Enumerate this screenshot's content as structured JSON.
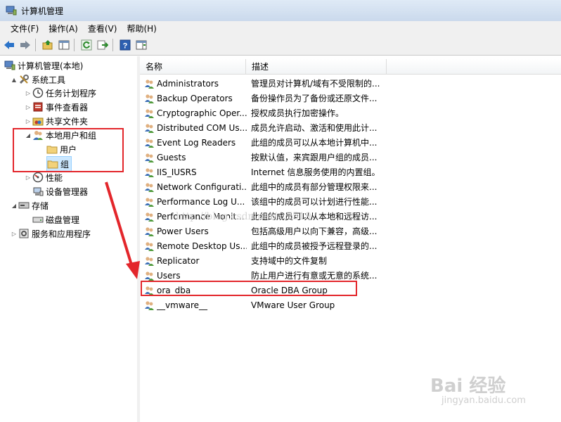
{
  "window": {
    "title": "计算机管理"
  },
  "menu": [
    "文件(F)",
    "操作(A)",
    "查看(V)",
    "帮助(H)"
  ],
  "toolbar_icons": [
    "back-icon",
    "forward-icon",
    "up-folder-icon",
    "show-hide-tree-icon",
    "refresh-icon",
    "export-list-icon",
    "help-icon",
    "action-pane-icon"
  ],
  "tree": [
    {
      "label": "计算机管理(本地)",
      "icon": "computer-management-icon",
      "arrow": ""
    },
    {
      "label": "系统工具",
      "icon": "tools-icon",
      "arrow": "▲"
    },
    {
      "label": "任务计划程序",
      "icon": "clock-icon",
      "arrow": "▷"
    },
    {
      "label": "事件查看器",
      "icon": "event-viewer-icon",
      "arrow": "▷"
    },
    {
      "label": "共享文件夹",
      "icon": "shared-folder-icon",
      "arrow": "▷"
    },
    {
      "label": "本地用户和组",
      "icon": "users-icon",
      "arrow": "◢"
    },
    {
      "label": "用户",
      "icon": "folder-icon",
      "arrow": ""
    },
    {
      "label": "组",
      "icon": "folder-icon",
      "arrow": ""
    },
    {
      "label": "性能",
      "icon": "performance-icon",
      "arrow": "▷"
    },
    {
      "label": "设备管理器",
      "icon": "device-manager-icon",
      "arrow": ""
    },
    {
      "label": "存储",
      "icon": "storage-icon",
      "arrow": "◢"
    },
    {
      "label": "磁盘管理",
      "icon": "disk-icon",
      "arrow": ""
    },
    {
      "label": "服务和应用程序",
      "icon": "services-icon",
      "arrow": "▷"
    }
  ],
  "columns": {
    "name": "名称",
    "desc": "描述"
  },
  "groups": [
    {
      "name": "Administrators",
      "desc": "管理员对计算机/域有不受限制的..."
    },
    {
      "name": "Backup Operators",
      "desc": "备份操作员为了备份或还原文件..."
    },
    {
      "name": "Cryptographic Oper...",
      "desc": "授权成员执行加密操作。"
    },
    {
      "name": "Distributed COM Us...",
      "desc": "成员允许启动、激活和使用此计..."
    },
    {
      "name": "Event Log Readers",
      "desc": "此组的成员可以从本地计算机中..."
    },
    {
      "name": "Guests",
      "desc": "按默认值，来宾跟用户组的成员..."
    },
    {
      "name": "IIS_IUSRS",
      "desc": "Internet 信息服务使用的内置组。"
    },
    {
      "name": "Network Configurati...",
      "desc": "此组中的成员有部分管理权限来..."
    },
    {
      "name": "Performance Log U...",
      "desc": "该组中的成员可以计划进行性能..."
    },
    {
      "name": "Performance Monit...",
      "desc": "此组的成员可以从本地和远程访..."
    },
    {
      "name": "Power Users",
      "desc": "包括高级用户以向下兼容，高级..."
    },
    {
      "name": "Remote Desktop Us...",
      "desc": "此组中的成员被授予远程登录的..."
    },
    {
      "name": "Replicator",
      "desc": "支持域中的文件复制"
    },
    {
      "name": "Users",
      "desc": "防止用户进行有意或无意的系统..."
    },
    {
      "name": "ora_dba",
      "desc": "Oracle DBA Group"
    },
    {
      "name": "__vmware__",
      "desc": "VMware User Group"
    }
  ],
  "watermarks": {
    "csdn": "http://blog.csdn.net/...7519",
    "baidu": "Bai 经验",
    "site": "jingyan.baidu.com"
  },
  "colors": {
    "highlight": "#e3262b",
    "selected_bg": "#cce8ff"
  }
}
